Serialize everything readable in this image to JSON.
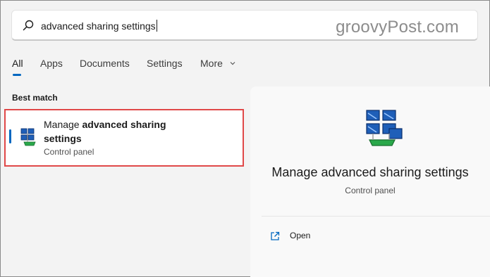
{
  "search": {
    "query": "advanced sharing settings",
    "icon": "search-icon"
  },
  "watermark": "groovyPost.com",
  "tabs": [
    {
      "label": "All",
      "active": true
    },
    {
      "label": "Apps"
    },
    {
      "label": "Documents"
    },
    {
      "label": "Settings"
    },
    {
      "label": "More"
    }
  ],
  "best_match": {
    "heading": "Best match",
    "result": {
      "title_plain": "Manage ",
      "title_bold_1": "advanced sharing",
      "title_bold_2": "settings",
      "subtitle": "Control panel",
      "icon": "network-sharing-icon"
    }
  },
  "preview": {
    "title": "Manage advanced sharing settings",
    "subtitle": "Control panel",
    "icon": "network-sharing-icon",
    "actions": [
      {
        "label": "Open",
        "icon": "open-external-icon"
      }
    ]
  },
  "colors": {
    "accent": "#0067c0",
    "highlight_border": "#e04848",
    "background": "#f3f3f3"
  }
}
